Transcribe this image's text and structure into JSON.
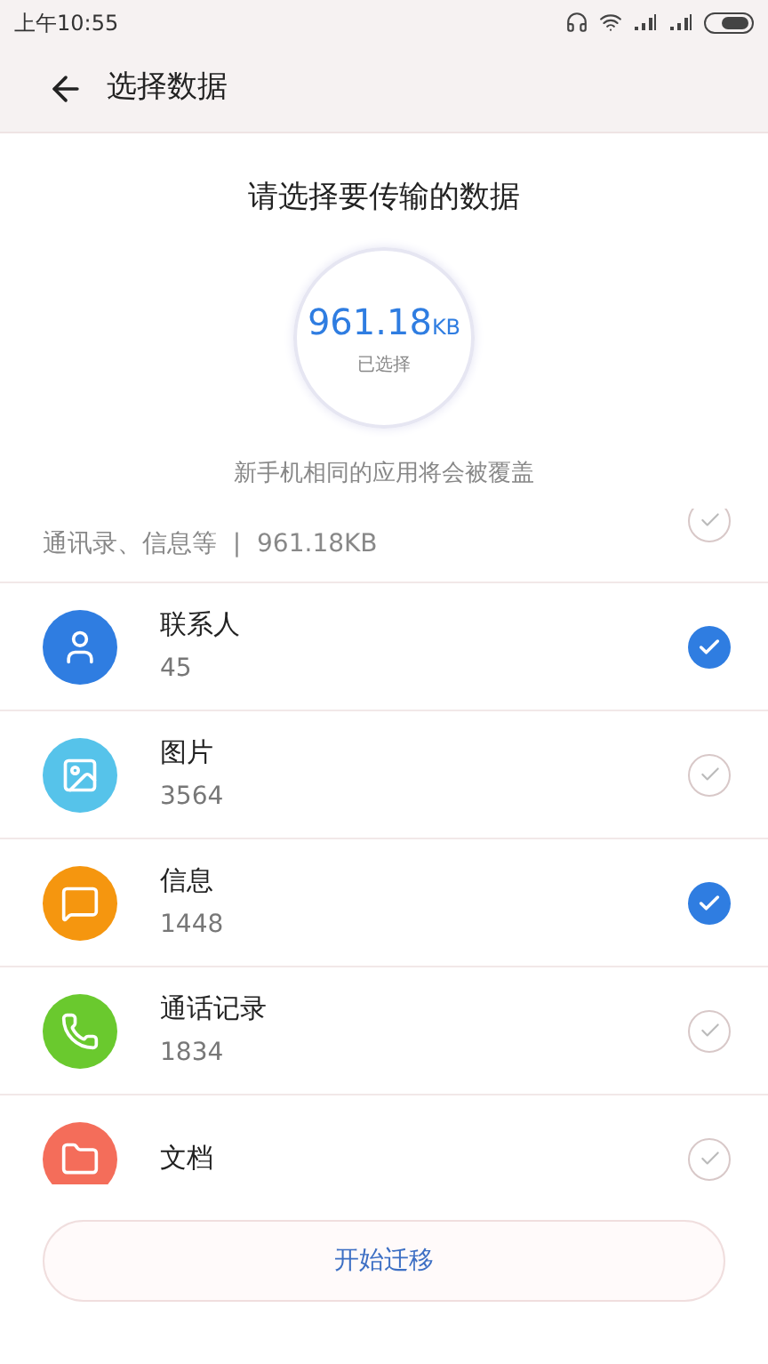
{
  "status_bar": {
    "time": "上午10:55"
  },
  "header": {
    "title": "选择数据"
  },
  "heading": "请选择要传输的数据",
  "total": {
    "size": "961.18",
    "unit": "KB",
    "caption": "已选择"
  },
  "notice": "新手机相同的应用将会被覆盖",
  "summary": {
    "text": "通讯录、信息等  |  961.18KB",
    "checked": false
  },
  "items": [
    {
      "kind": "contacts",
      "name": "联系人",
      "count": "45",
      "color": "#2f7de1",
      "checked": true
    },
    {
      "kind": "pictures",
      "name": "图片",
      "count": "3564",
      "color": "#56c3ea",
      "checked": false
    },
    {
      "kind": "messages",
      "name": "信息",
      "count": "1448",
      "color": "#f5960f",
      "checked": true
    },
    {
      "kind": "calls",
      "name": "通话记录",
      "count": "1834",
      "color": "#6ac92e",
      "checked": false
    },
    {
      "kind": "documents",
      "name": "文档",
      "color": "#f46d5a",
      "checked": false
    }
  ],
  "button": "开始迁移"
}
